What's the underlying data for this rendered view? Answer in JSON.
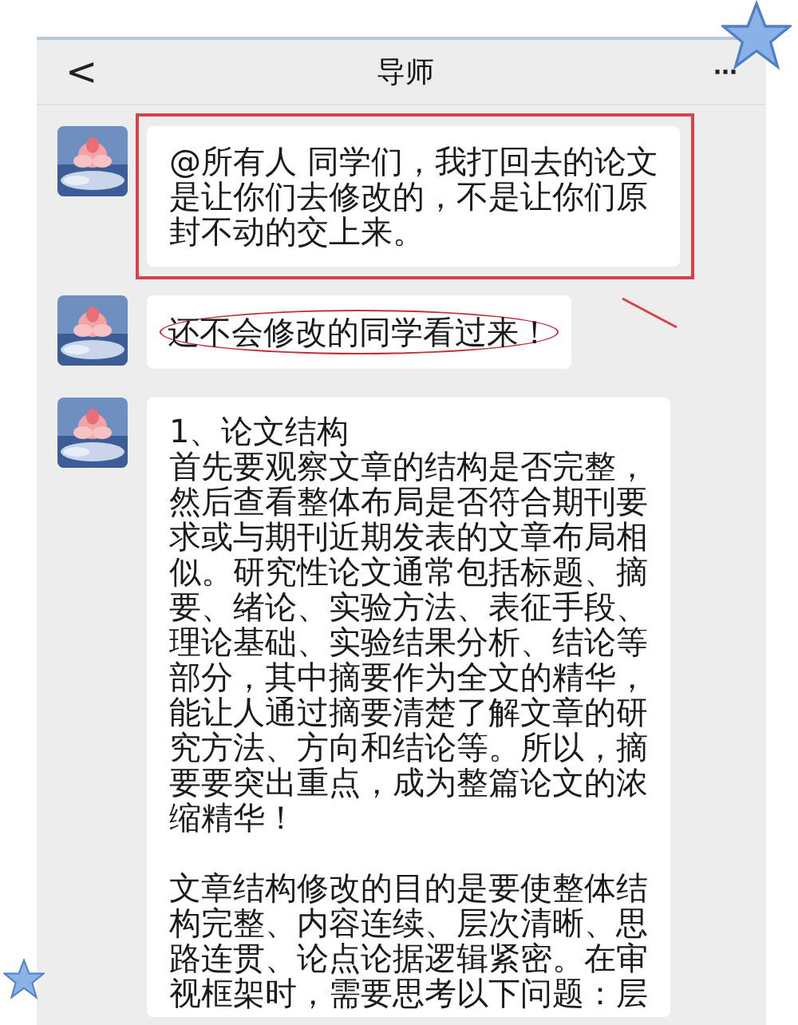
{
  "header": {
    "back": "<",
    "title": "导师",
    "more": "···"
  },
  "messages": [
    {
      "kind": "text",
      "boxed": true,
      "circled": false,
      "paragraphs": [
        [
          "@所有人 同学们，我打回去的论文",
          "是让你们去修改的，不是让你们原",
          "封不动的交上来。"
        ]
      ]
    },
    {
      "kind": "text",
      "boxed": false,
      "circled": true,
      "paragraphs": [
        [
          "还不会修改的同学看过来！"
        ]
      ]
    },
    {
      "kind": "text",
      "boxed": false,
      "circled": false,
      "paragraphs": [
        [
          "1、论文结构",
          "首先要观察文章的结构是否完整，",
          "然后查看整体布局是否符合期刊要",
          "求或与期刊近期发表的文章布局相",
          "似。研究性论文通常包括标题、摘",
          "要、绪论、实验方法、表征手段、",
          "理论基础、实验结果分析、结论等",
          "部分，其中摘要作为全文的精华，",
          "能让人通过摘要清楚了解文章的研",
          "究方法、方向和结论等。所以，摘",
          "要要突出重点，成为整篇论文的浓",
          "缩精华！"
        ],
        [
          "文章结构修改的目的是要使整体结",
          "构完整、内容连续、层次清晰、思",
          "路连贯、论点论据逻辑紧密。在审",
          "视框架时，需要思考以下问题：层"
        ]
      ]
    }
  ]
}
